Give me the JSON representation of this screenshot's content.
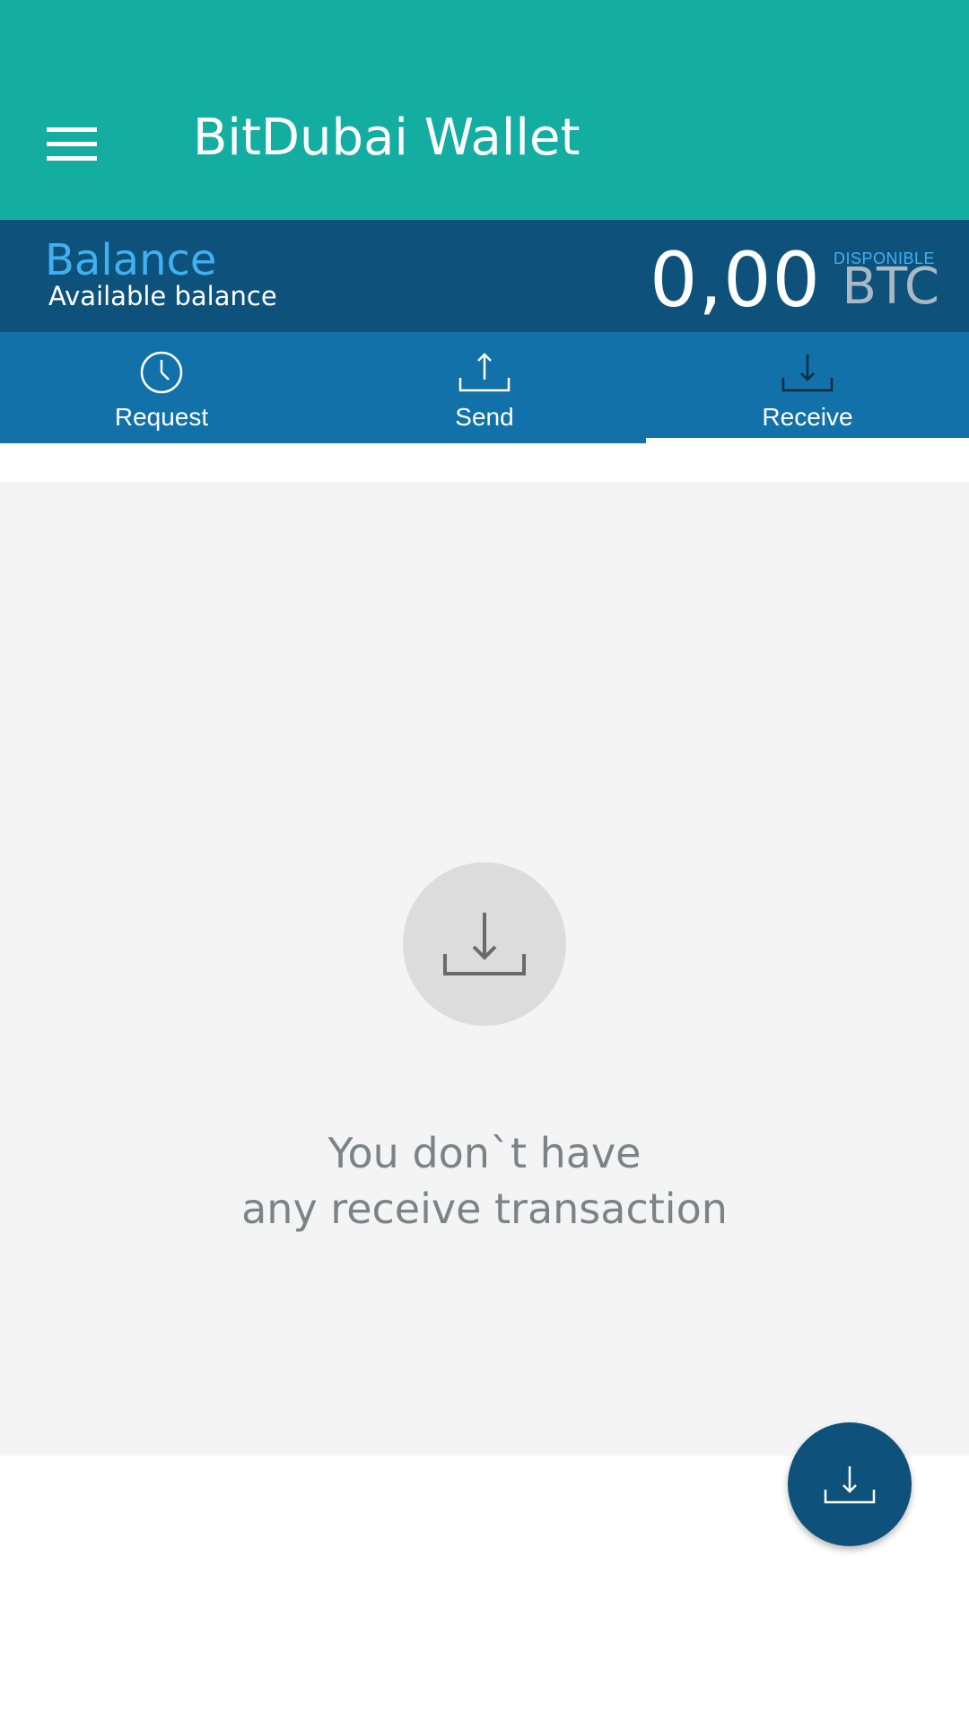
{
  "appbar": {
    "title": "BitDubai Wallet",
    "menu_icon": "hamburger-menu-icon",
    "background": "#14ada1"
  },
  "balance": {
    "title": "Balance",
    "subtitle": "Available balance",
    "amount": "0,00",
    "availability": "DISPONIBLE",
    "unit": "BTC",
    "background": "#0e527c",
    "accent": "#41b0f0"
  },
  "tabs": [
    {
      "label": "Request",
      "icon": "clock-icon",
      "active": false
    },
    {
      "label": "Send",
      "icon": "upload-icon",
      "active": false
    },
    {
      "label": "Receive",
      "icon": "download-icon",
      "active": true
    }
  ],
  "empty_state": {
    "icon": "download-icon",
    "line1": "You don`t have",
    "line2": "any receive transaction"
  },
  "fab": {
    "icon": "download-icon",
    "background": "#0e527c"
  }
}
